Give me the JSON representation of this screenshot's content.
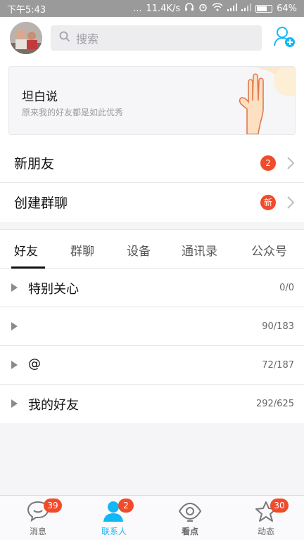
{
  "status_bar": {
    "time": "下午5:43",
    "dots": "...",
    "speed": "11.4K/s",
    "battery": "64%"
  },
  "header": {
    "search_placeholder": "搜索"
  },
  "banner": {
    "title": "坦白说",
    "subtitle": "原来我的好友都是如此优秀"
  },
  "rows": [
    {
      "label": "新朋友",
      "badge": "2"
    },
    {
      "label": "创建群聊",
      "badge": "新"
    }
  ],
  "tabs": [
    "好友",
    "群聊",
    "设备",
    "通讯录",
    "公众号"
  ],
  "groups": [
    {
      "name": "特别关心",
      "count": "0/0"
    },
    {
      "name": "",
      "count": "90/183"
    },
    {
      "name": "@",
      "count": "72/187"
    },
    {
      "name": "我的好友",
      "count": "292/625"
    }
  ],
  "bottom_nav": [
    {
      "label": "消息",
      "badge": "39",
      "icon": "message-icon"
    },
    {
      "label": "联系人",
      "badge": "2",
      "icon": "contacts-icon"
    },
    {
      "label": "看点",
      "badge": "",
      "icon": "eye-icon"
    },
    {
      "label": "动态",
      "badge": "30",
      "icon": "star-icon"
    }
  ],
  "colors": {
    "accent": "#12b7f5",
    "badge": "#f04b2b"
  }
}
